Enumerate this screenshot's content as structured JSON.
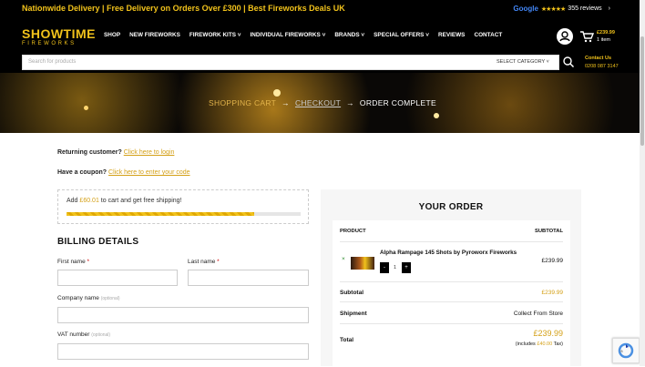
{
  "topbar": {
    "promo": "Nationwide Delivery | Free Delivery on Orders Over £300 | Best Fireworks Deals UK",
    "google": "Google",
    "stars": "★★★★★",
    "reviews": "355 reviews",
    "arrow": "›"
  },
  "header": {
    "logo_line1": "SHOWTIME",
    "logo_line2": "FIREWORKS",
    "nav": [
      "SHOP",
      "NEW FIREWORKS",
      "FIREWORK KITS ˅",
      "INDIVIDUAL FIREWORKS ˅",
      "BRANDS ˅",
      "SPECIAL OFFERS ˅",
      "REVIEWS",
      "CONTACT"
    ],
    "cart_total": "£239.99",
    "cart_count": "1 item"
  },
  "search": {
    "placeholder": "Search for products",
    "category": "SELECT CATEGORY ˅"
  },
  "contact": {
    "title": "Contact Us",
    "phone": "0208 087 3147"
  },
  "breadcrumb": {
    "step1": "SHOPPING CART",
    "sep": "→",
    "step2": "CHECKOUT",
    "step3": "ORDER COMPLETE"
  },
  "notices": {
    "returning": "Returning customer?",
    "returning_link": "Click here to login",
    "coupon": "Have a coupon?",
    "coupon_link": "Click here to enter your code"
  },
  "shipping": {
    "pre": "Add",
    "amount": "£60.01",
    "post": "to cart and get free shipping!",
    "progress": 0.8
  },
  "billing": {
    "title": "BILLING DETAILS",
    "first_name": "First name",
    "last_name": "Last name",
    "company": "Company name",
    "vat": "VAT number",
    "required_mark": "*",
    "optional": "(optional)"
  },
  "order": {
    "title": "YOUR ORDER",
    "col_product": "PRODUCT",
    "col_subtotal": "SUBTOTAL",
    "remove": "×",
    "product_name": "Alpha Rampage 145 Shots by Pyroworx Fireworks",
    "qty": "1",
    "qty_minus": "-",
    "qty_plus": "+",
    "product_price": "£239.99",
    "subtotal_label": "Subtotal",
    "subtotal_value": "£239.99",
    "shipment_label": "Shipment",
    "shipment_value": "Collect From Store",
    "total_label": "Total",
    "total_value": "£239.99",
    "tax_pre": "(includes",
    "tax_amount": "£40.00",
    "tax_post": "Tax)"
  }
}
